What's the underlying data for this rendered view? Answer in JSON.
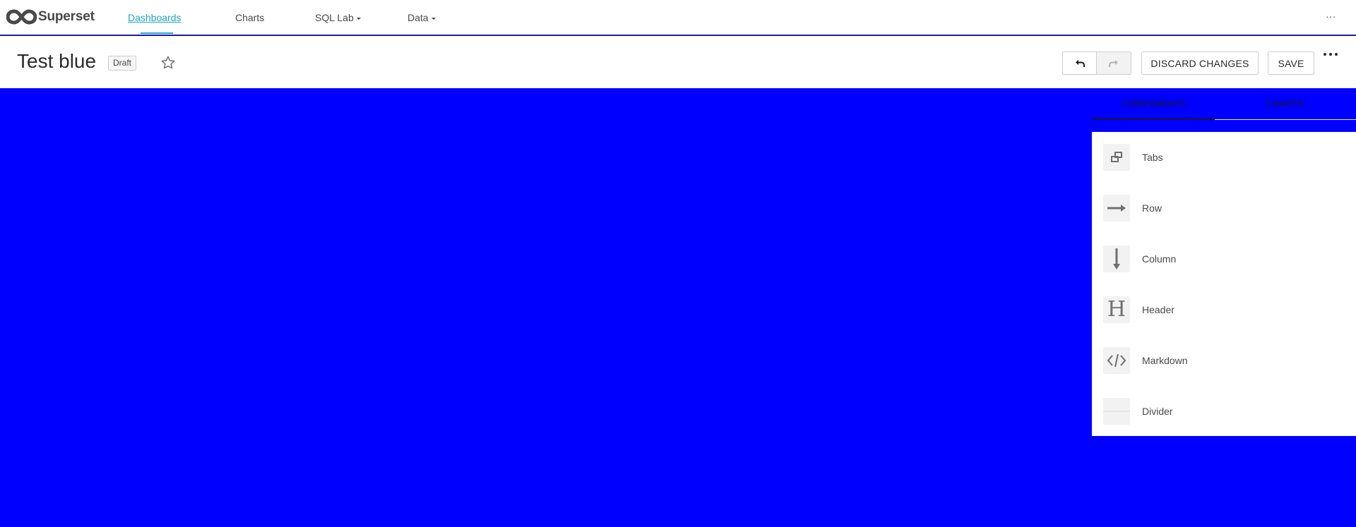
{
  "navbar": {
    "brand": "Superset",
    "items": [
      {
        "label": "Dashboards"
      },
      {
        "label": "Charts"
      },
      {
        "label": "SQL Lab"
      },
      {
        "label": "Data"
      }
    ],
    "more_label": "..."
  },
  "dashboard": {
    "title": "Test blue",
    "status_badge": "Draft",
    "discard_label": "DISCARD CHANGES",
    "save_label": "SAVE",
    "background_color": "#0000ff"
  },
  "builder": {
    "tabs": [
      {
        "label": "COMPONENTS"
      },
      {
        "label": "CHARTS"
      }
    ],
    "components": [
      {
        "label": "Tabs",
        "icon": "tabs-icon"
      },
      {
        "label": "Row",
        "icon": "arrow-right-icon"
      },
      {
        "label": "Column",
        "icon": "arrow-down-icon"
      },
      {
        "label": "Header",
        "icon": "header-icon"
      },
      {
        "label": "Markdown",
        "icon": "code-icon"
      },
      {
        "label": "Divider",
        "icon": "divider-icon"
      }
    ]
  }
}
